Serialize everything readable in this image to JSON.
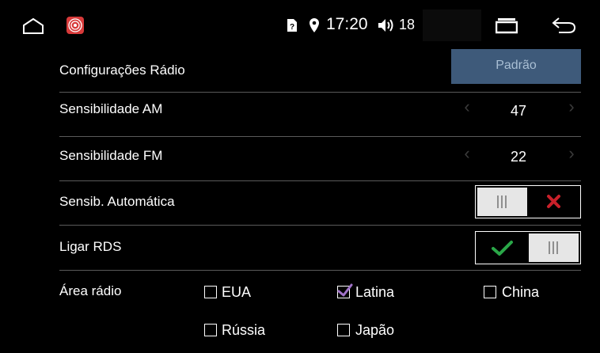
{
  "status_bar": {
    "time": "17:20",
    "volume_level": "18",
    "icons": [
      "home-icon",
      "radio-app-icon",
      "sim-unknown-icon",
      "location-pin-icon",
      "volume-icon",
      "recent-apps-icon",
      "back-icon"
    ]
  },
  "header": {
    "title": "Configurações Rádio",
    "default_button_label": "Padrão"
  },
  "settings": {
    "am_sensitivity": {
      "label": "Sensibilidade AM",
      "value": "47"
    },
    "fm_sensitivity": {
      "label": "Sensibilidade FM",
      "value": "22"
    },
    "auto_sensitivity": {
      "label": "Sensib. Automática",
      "state": "off"
    },
    "rds": {
      "label": "Ligar RDS",
      "state": "on"
    },
    "radio_area": {
      "label": "Área rádio",
      "options": [
        {
          "label": "EUA",
          "checked": false
        },
        {
          "label": "Latina",
          "checked": true
        },
        {
          "label": "China",
          "checked": false
        },
        {
          "label": "Rússia",
          "checked": false
        },
        {
          "label": "Japão",
          "checked": false
        }
      ]
    }
  },
  "colors": {
    "background": "#000000",
    "default_button_bg": "#3e5a7a",
    "default_button_text": "#a9bfd4",
    "toggle_knob": "#e6e6e6",
    "off_x": "#c8202a",
    "on_check": "#2aa748",
    "checkbox_check": "#a072c8",
    "divider": "#5a5a5a",
    "arrow_dim": "#3b3b3b"
  }
}
